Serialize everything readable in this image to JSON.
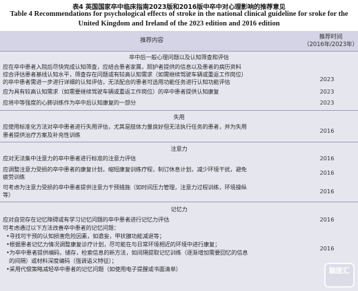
{
  "caption": {
    "zh": "表4   英国国家卒中临床指南2023版和2016版中卒中对心理影响的推荐意见",
    "en_line1": "Table 4    Recommendations for psychological effects of stroke in the national clinical guideline for sroke for the",
    "en_line2": "United Kingdom and Ireland of the 2023 edition and 2016 edition"
  },
  "header": {
    "content": "推荐内容",
    "year_line1": "推荐时间",
    "year_line2": "（2016年/2023年）"
  },
  "sections": [
    {
      "title": "卒中后一般心理问题以及认知筛查和评估",
      "lines": [
        "应在卒中患者入院后尽快完成认知筛查，应结合患者家属，照护者提供的信息以及患者的病历资料",
        "综合评估患者基线认知水平，筛查存在问题或有较高认知需求（如需继续驾驶车辆或重返工作岗位）",
        "的卒中患者需进一步进行详细的认知评估，无法配合的患者可选用功能任务进行认知功能评估",
        "应为具有较高认知需求（如需要继续驾驶车辆或重返工作岗位）的卒中患者提供认知康复",
        "应将中等强度的心肺训练作为卒中后认知康复的一部分"
      ],
      "years": [
        "2023",
        "2023",
        "2023"
      ]
    },
    {
      "title": "失用",
      "lines": [
        "应使用标准化方法对卒中患者进行失用评估，尤其是肢体力量良好但无法执行任务的患者，并为失用",
        "患者提供治疗方案及补充性训练"
      ],
      "years": [
        "2016"
      ]
    },
    {
      "title": "注意力",
      "lines": [
        "应对无法集中注意力的卒中患者进行标准的注意力评估",
        "应调整注意力受损的卒中患者的康复计划，缩短康复训练疗程，制订休息计划，减少环境干扰，避免",
        "疲劳训练",
        "可考虑为注意力受损的卒中患者提供注意力干预措施（如时间压力管理，注意力过程训练，环境操纵",
        "等）"
      ],
      "years": [
        "2016",
        "2016",
        "2016"
      ]
    },
    {
      "title": "记忆力",
      "lines": [
        "应对自觉存在记忆障碍或有学习记忆问题的卒中患者进行记忆力评估",
        "可考虑通过以下方法改善卒中患者的记忆问题：",
        "•寻找可干预的认知损害危险因素，如谵妄，甲状腺功能减退等；",
        "•根据患者记忆力情况调整康复诊疗计划，尽可能在与日常环境相近的环境中进行康复；",
        "•为卒中患者提供编码，储存，检索信息的新方法，如间隔提取记忆训练（逐渐增加需要回忆的信息",
        "的间隔）或材料深度编码（强调语义特征）；",
        "•采用代偿策略减轻卒中患者的记忆问题（如使用电子提醒或书面清单）"
      ],
      "years": [
        "2016",
        "2016"
      ]
    }
  ],
  "watermark": "脑医汇"
}
